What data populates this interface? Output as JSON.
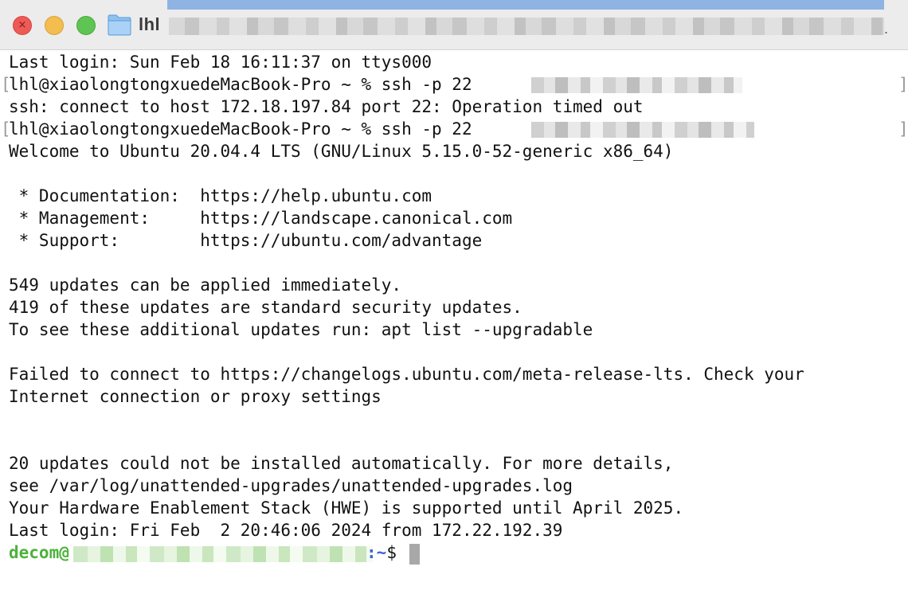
{
  "window": {
    "title": "lhl",
    "title_dot": "."
  },
  "controls": {
    "close_glyph": "×"
  },
  "terminal": {
    "lines": [
      "Last login: Sun Feb 18 16:11:37 on ttys000",
      "lhl@xiaolongtongxuedeMacBook-Pro ~ % ssh -p 22 ",
      "ssh: connect to host 172.18.197.84 port 22: Operation timed out",
      "lhl@xiaolongtongxuedeMacBook-Pro ~ % ssh -p 22 ",
      "Welcome to Ubuntu 20.04.4 LTS (GNU/Linux 5.15.0-52-generic x86_64)",
      "",
      " * Documentation:  https://help.ubuntu.com",
      " * Management:     https://landscape.canonical.com",
      " * Support:        https://ubuntu.com/advantage",
      "",
      "549 updates can be applied immediately.",
      "419 of these updates are standard security updates.",
      "To see these additional updates run: apt list --upgradable",
      "",
      "Failed to connect to https://changelogs.ubuntu.com/meta-release-lts. Check your",
      "Internet connection or proxy settings",
      "",
      "",
      "20 updates could not be installed automatically. For more details,",
      "see /var/log/unattended-upgrades/unattended-upgrades.log",
      "Your Hardware Enablement Stack (HWE) is supported until April 2025.",
      "Last login: Fri Feb  2 20:46:06 2024 from 172.22.192.39"
    ],
    "bracket_open": "[",
    "bracket_close": "]",
    "prompt": {
      "user": "decom@",
      "separator": ":",
      "path": "~",
      "symbol": "$"
    }
  },
  "colors": {
    "prompt_user": "#4bb33a",
    "prompt_path": "#3f63d6",
    "close_button": "#ee5b56",
    "minimize_button": "#f3bd4f",
    "zoom_button": "#5ec453"
  },
  "icons": {
    "title_icon": "folder-icon"
  }
}
